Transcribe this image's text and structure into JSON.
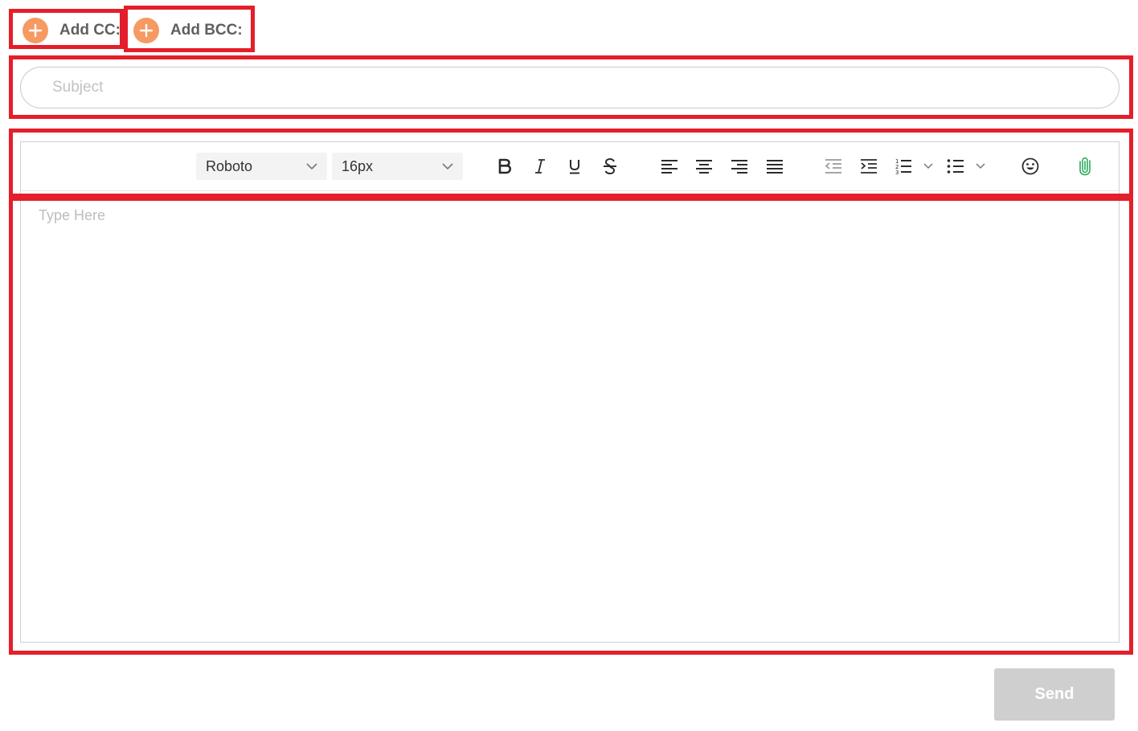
{
  "recipients": {
    "add_cc_label": "Add CC:",
    "add_bcc_label": "Add BCC:"
  },
  "subject": {
    "placeholder": "Subject",
    "value": ""
  },
  "toolbar": {
    "font_family": "Roboto",
    "font_size": "16px",
    "buttons": [
      "bold",
      "italic",
      "underline",
      "strikethrough",
      "align-left",
      "align-center",
      "align-right",
      "align-justify",
      "outdent",
      "indent",
      "ordered-list",
      "bullet-list",
      "emoji",
      "attachment"
    ]
  },
  "editor": {
    "placeholder": "Type Here"
  },
  "actions": {
    "send_label": "Send"
  },
  "colors": {
    "accent_orange": "#f59a63",
    "highlight_red": "#e41e2a",
    "attachment_green": "#2eaa5c",
    "send_disabled": "#cfcfcf"
  }
}
